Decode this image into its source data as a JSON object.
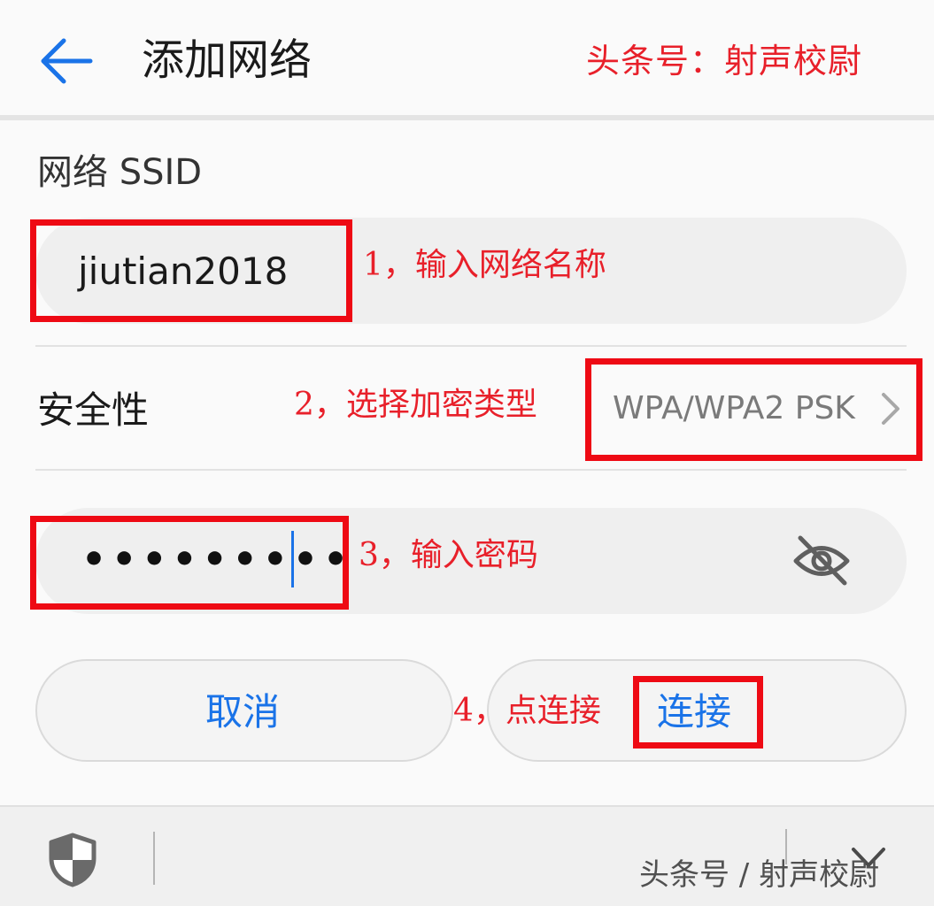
{
  "header": {
    "back_icon": "arrow-left-icon",
    "title": "添加网络",
    "watermark": "头条号：射声校尉"
  },
  "form": {
    "ssid_label": "网络 SSID",
    "ssid_value": "jiutian2018",
    "security_label": "安全性",
    "security_value": "WPA/WPA2 PSK",
    "security_chevron_icon": "chevron-right-icon",
    "password_value": "•••••••••",
    "password_toggle_icon": "eye-off-icon"
  },
  "buttons": {
    "cancel": "取消",
    "connect": "连接"
  },
  "annotations": {
    "step1": "1，输入网络名称",
    "step2": "2，选择加密类型",
    "step3": "3，输入密码",
    "step4": "4，点连接"
  },
  "bottom_bar": {
    "shield_icon": "shield-icon",
    "collapse_icon": "chevron-down-icon",
    "watermark": "头条号 / 射声校尉"
  },
  "colors": {
    "accent": "#1a73e8",
    "annotation_red": "#e8202a",
    "highlight_red": "#ee0a14",
    "input_bg": "#efefef"
  }
}
